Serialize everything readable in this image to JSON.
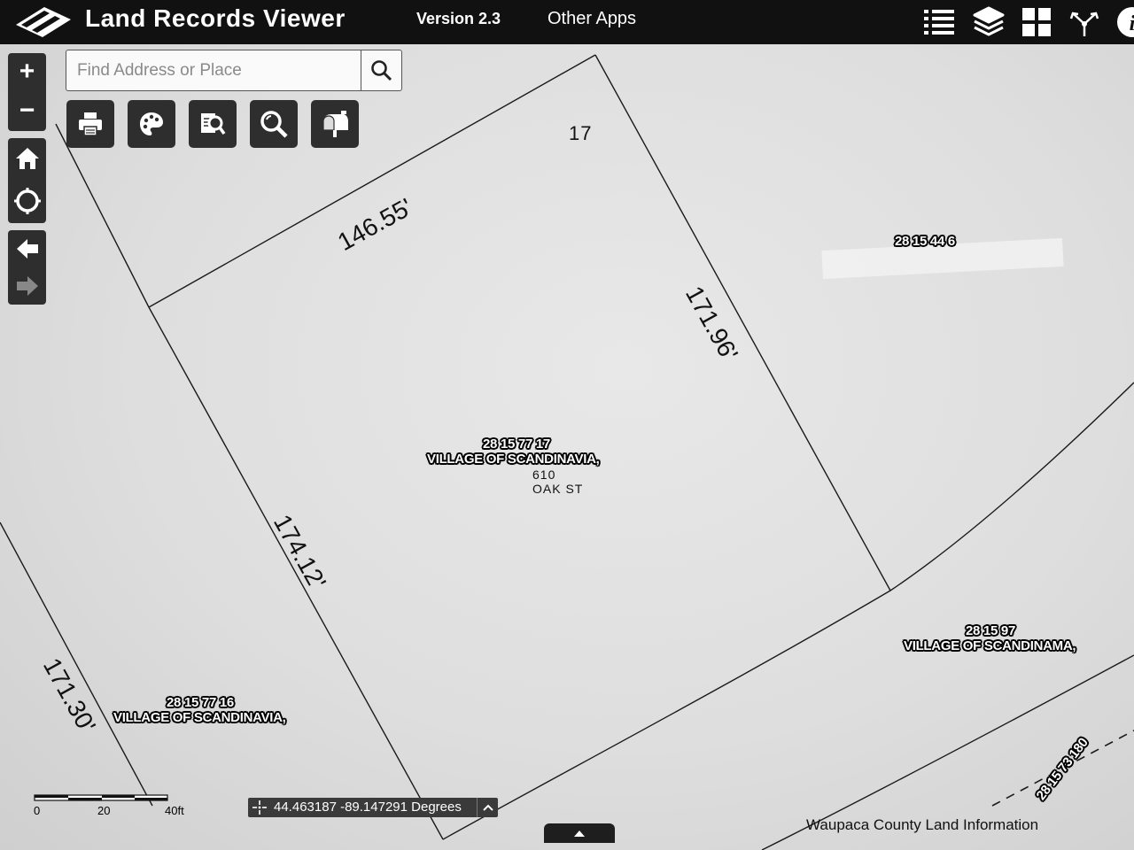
{
  "header": {
    "app_title": "Land Records Viewer",
    "version": "Version 2.3",
    "other_apps": "Other Apps",
    "icons": [
      "list-icon",
      "layers-icon",
      "grid-icon",
      "share-icon",
      "info-icon"
    ]
  },
  "nav": {
    "zoom_in": "+",
    "zoom_out": "−",
    "icons": [
      "home-icon",
      "locate-icon",
      "back-arrow-icon",
      "forward-arrow-icon"
    ]
  },
  "search": {
    "placeholder": "Find Address or Place",
    "value": ""
  },
  "toolbar": {
    "icons": [
      "print-icon",
      "palette-icon",
      "search-document-icon",
      "magnifier-icon",
      "mailbox-icon"
    ]
  },
  "map": {
    "lot_number": "17",
    "main_parcel": {
      "id": "28 15 77 17",
      "owner": "VILLAGE OF SCANDINAVIA,",
      "address_number": "610",
      "street": "OAK ST"
    },
    "parcel_east": {
      "id": "28 15 44 6"
    },
    "parcel_southeast": {
      "id": "28 15 97",
      "owner": "VILLAGE OF SCANDINAMA,"
    },
    "parcel_southwest": {
      "id": "28 15 77 16",
      "owner": "VILLAGE OF SCANDINAVIA,"
    },
    "parcel_far_se": {
      "id": "28 15 73 180"
    },
    "dimensions": {
      "north": "146.55'",
      "east": "171.96'",
      "west": "174.12'",
      "far_west": "171.30'"
    }
  },
  "scalebar": {
    "labels": [
      "0",
      "20",
      "40ft"
    ]
  },
  "coordinates": "44.463187 -89.147291 Degrees",
  "attribution": "Waupaca County Land Information",
  "colors": {
    "header": "#111111",
    "button": "#2e2e2e",
    "map": "#dedede"
  }
}
